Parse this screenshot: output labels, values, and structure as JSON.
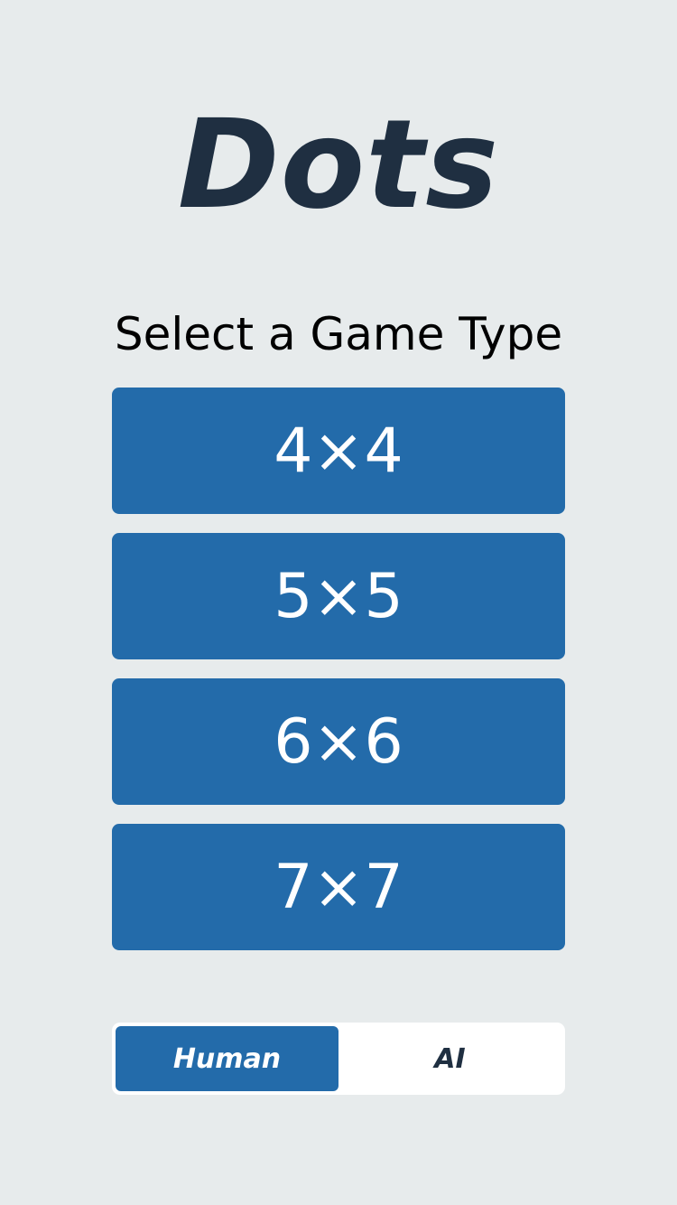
{
  "app": {
    "title": "Dots",
    "subtitle": "Select a Game Type"
  },
  "game_types": [
    {
      "label": "4×4"
    },
    {
      "label": "5×5"
    },
    {
      "label": "6×6"
    },
    {
      "label": "7×7"
    }
  ],
  "player_mode": {
    "options": [
      {
        "label": "Human",
        "selected": true
      },
      {
        "label": "AI",
        "selected": false
      }
    ]
  },
  "colors": {
    "background": "#e7ebec",
    "accent": "#236baa",
    "title": "#1f2f41"
  }
}
